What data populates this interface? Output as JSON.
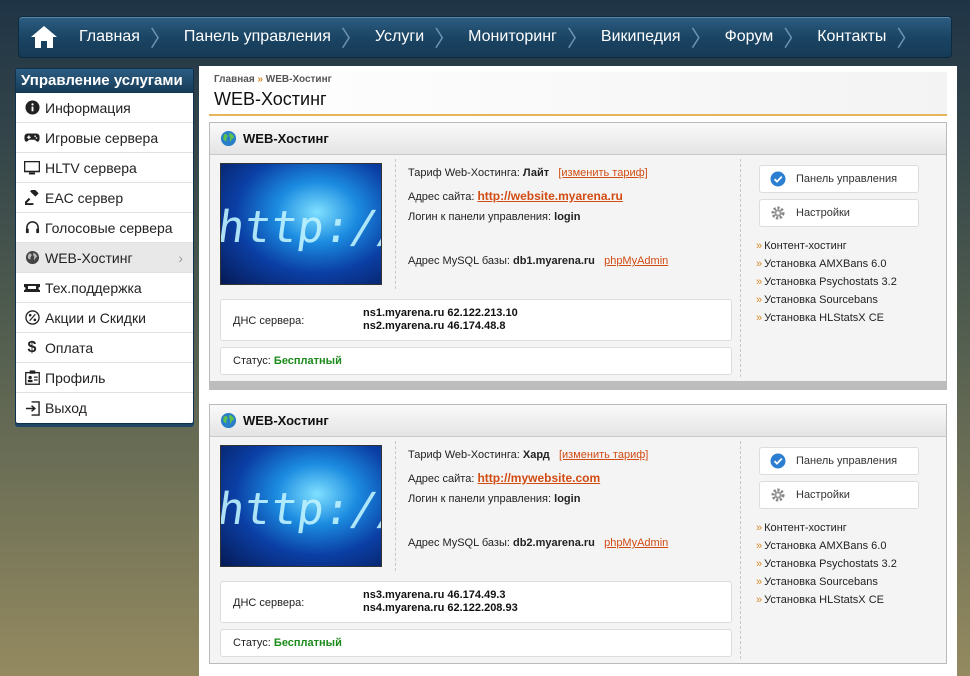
{
  "nav": {
    "items": [
      "Главная",
      "Панель управления",
      "Услуги",
      "Мониторинг",
      "Википедия",
      "Форум",
      "Контакты"
    ]
  },
  "sidebar": {
    "title": "Управление услугами",
    "items": [
      {
        "label": "Информация",
        "icon": "info-icon"
      },
      {
        "label": "Игровые сервера",
        "icon": "gamepad-icon"
      },
      {
        "label": "HLTV сервера",
        "icon": "monitor-icon"
      },
      {
        "label": "EAC сервер",
        "icon": "gavel-icon"
      },
      {
        "label": "Голосовые сервера",
        "icon": "headset-icon"
      },
      {
        "label": "WEB-Хостинг",
        "icon": "globe-icon",
        "active": true
      },
      {
        "label": "Тех.поддержка",
        "icon": "ticket-icon"
      },
      {
        "label": "Акции и Скидки",
        "icon": "percent-icon"
      },
      {
        "label": "Оплата",
        "icon": "dollar-icon"
      },
      {
        "label": "Профиль",
        "icon": "profile-icon"
      },
      {
        "label": "Выход",
        "icon": "logout-icon"
      }
    ]
  },
  "page": {
    "breadcrumb_home": "Главная",
    "breadcrumb_sep": "»",
    "breadcrumb_current": "WEB-Хостинг",
    "title": "WEB-Хостинг"
  },
  "common": {
    "tariff_label": "Тариф Web-Хостинга:",
    "change_tariff": "[изменить тариф]",
    "site_label": "Адрес сайта:",
    "login_label": "Логин к панели управления:",
    "mysql_label": "Адрес MySQL базы:",
    "phpmyadmin": "phpMyAdmin",
    "dns_label": "ДНС сервера:",
    "status_label": "Статус:",
    "panel_button": "Панель управления",
    "settings_button": "Настройки",
    "links": [
      "Контент-хостинг",
      "Установка AMXBans 6.0",
      "Установка Psychostats 3.2",
      "Установка Sourcebans",
      "Установка HLStatsX CE"
    ]
  },
  "cards": [
    {
      "title": "WEB-Хостинг",
      "tariff": "Лайт",
      "site": "http://website.myarena.ru",
      "login": "login",
      "mysql": "db1.myarena.ru",
      "dns1": "ns1.myarena.ru 62.122.213.10",
      "dns2": "ns2.myarena.ru 46.174.48.8",
      "status": "Бесплатный"
    },
    {
      "title": "WEB-Хостинг",
      "tariff": "Хард",
      "site": "http://mywebsite.com",
      "login": "login",
      "mysql": "db2.myarena.ru",
      "dns1": "ns3.myarena.ru 46.174.49.3",
      "dns2": "ns4.myarena.ru 62.122.208.93",
      "status": "Бесплатный"
    }
  ],
  "thumb_text": "http://www."
}
